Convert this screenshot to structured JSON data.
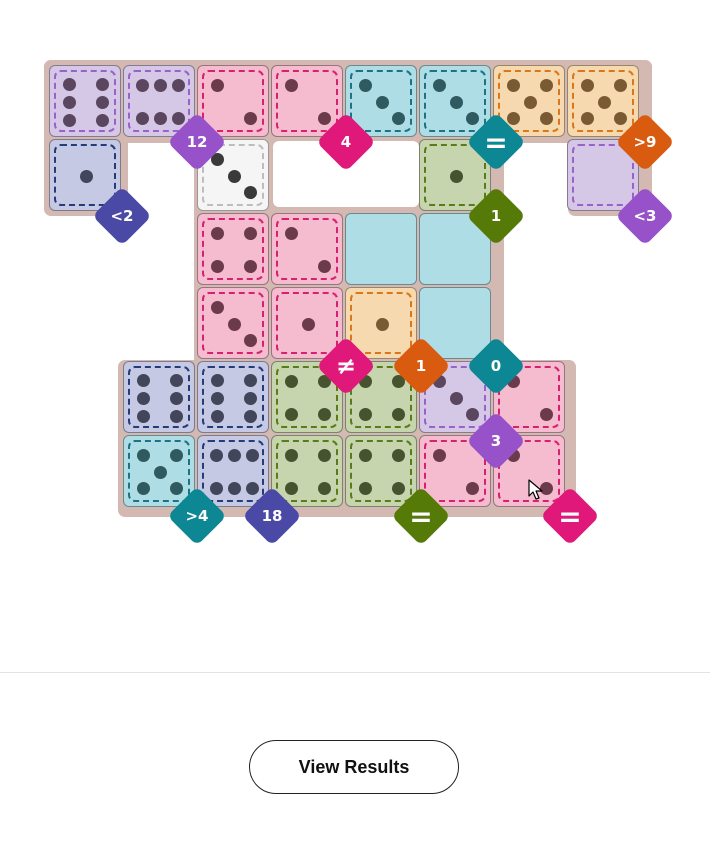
{
  "colors": {
    "region_border": "#d3b9b2",
    "purple": {
      "fill": "#d5c7e6",
      "dash": "#9a61c8",
      "pip": "#5b4660"
    },
    "pink": {
      "fill": "#f5bcd0",
      "dash": "#d6226e",
      "pip": "#6b3b4c"
    },
    "teal": {
      "fill": "#aedde5",
      "dash": "#1d7384",
      "pip": "#2f5a60"
    },
    "orange": {
      "fill": "#f6d9ae",
      "dash": "#d9781a",
      "pip": "#7a5a33"
    },
    "navy": {
      "fill": "#c5c9e3",
      "dash": "#253c7a",
      "pip": "#43455a"
    },
    "olive": {
      "fill": "#c6d5ad",
      "dash": "#5b7b1a",
      "pip": "#46532e"
    },
    "white": {
      "fill": "#f5f5f5",
      "dash": "#bdbdbd",
      "pip": "#3a3a3a"
    },
    "badges": {
      "purple": "#9751c9",
      "pink": "#e0187a",
      "teal": "#0e8794",
      "orange": "#d95b10",
      "navy": "#4a4aa6",
      "olive": "#567a08"
    }
  },
  "cells": [
    {
      "id": "r0c0",
      "color": "purple",
      "pips": 6
    },
    {
      "id": "r0c1",
      "color": "purple",
      "pips": 6,
      "horizontal": true
    },
    {
      "id": "r0c2",
      "color": "pink",
      "pips": 2
    },
    {
      "id": "r0c3",
      "color": "pink",
      "pips": 2
    },
    {
      "id": "r0c4",
      "color": "teal",
      "pips": 3
    },
    {
      "id": "r0c5",
      "color": "teal",
      "pips": 3
    },
    {
      "id": "r0c6",
      "color": "orange",
      "pips": 5
    },
    {
      "id": "r0c7",
      "color": "orange",
      "pips": 5
    },
    {
      "id": "r1c0",
      "color": "navy",
      "pips": 1
    },
    {
      "id": "r1c2",
      "color": "white",
      "pips": 3,
      "dark": true
    },
    {
      "id": "r1c5",
      "color": "olive",
      "pips": 1
    },
    {
      "id": "r1c7",
      "color": "purple",
      "pips": 0
    },
    {
      "id": "r2c2",
      "color": "pink",
      "pips": 4
    },
    {
      "id": "r2c3",
      "color": "pink",
      "pips": 2
    },
    {
      "id": "r2c4",
      "color": "teal",
      "pips": 0
    },
    {
      "id": "r2c5",
      "color": "teal",
      "pips": 0
    },
    {
      "id": "r3c2",
      "color": "pink",
      "pips": 3
    },
    {
      "id": "r3c3",
      "color": "pink",
      "pips": 1
    },
    {
      "id": "r3c4",
      "color": "orange",
      "pips": 1
    },
    {
      "id": "r3c5",
      "color": "teal",
      "pips": 0
    },
    {
      "id": "r4c1",
      "color": "navy",
      "pips": 6
    },
    {
      "id": "r4c2",
      "color": "navy",
      "pips": 6
    },
    {
      "id": "r4c3",
      "color": "olive",
      "pips": 4
    },
    {
      "id": "r4c4",
      "color": "olive",
      "pips": 4
    },
    {
      "id": "r4c5",
      "color": "purple",
      "pips": 3
    },
    {
      "id": "r4c6",
      "color": "pink",
      "pips": 2
    },
    {
      "id": "r5c1",
      "color": "teal",
      "pips": 5
    },
    {
      "id": "r5c2",
      "color": "navy",
      "pips": 6,
      "horizontal": true
    },
    {
      "id": "r5c3",
      "color": "olive",
      "pips": 4
    },
    {
      "id": "r5c4",
      "color": "olive",
      "pips": 4
    },
    {
      "id": "r5c5",
      "color": "pink",
      "pips": 2
    },
    {
      "id": "r5c6",
      "color": "pink",
      "pips": 2
    }
  ],
  "badges": [
    {
      "id": "b-lt2",
      "label": "<2",
      "color": "navy"
    },
    {
      "id": "b-12",
      "label": "12",
      "color": "purple"
    },
    {
      "id": "b-4",
      "label": "4",
      "color": "pink"
    },
    {
      "id": "b-eq-teal",
      "label": "=",
      "color": "teal"
    },
    {
      "id": "b-gt9",
      "label": ">9",
      "color": "orange"
    },
    {
      "id": "b-1-olive",
      "label": "1",
      "color": "olive"
    },
    {
      "id": "b-lt3",
      "label": "<3",
      "color": "purple"
    },
    {
      "id": "b-neq",
      "label": "≠",
      "color": "pink"
    },
    {
      "id": "b-1-orange",
      "label": "1",
      "color": "orange"
    },
    {
      "id": "b-0",
      "label": "0",
      "color": "teal"
    },
    {
      "id": "b-3",
      "label": "3",
      "color": "purple"
    },
    {
      "id": "b-gt4",
      "label": ">4",
      "color": "teal"
    },
    {
      "id": "b-18",
      "label": "18",
      "color": "navy"
    },
    {
      "id": "b-eq-olive",
      "label": "=",
      "color": "olive"
    },
    {
      "id": "b-eq-pink",
      "label": "=",
      "color": "pink"
    }
  ],
  "actions": {
    "view_results": "View Results"
  }
}
